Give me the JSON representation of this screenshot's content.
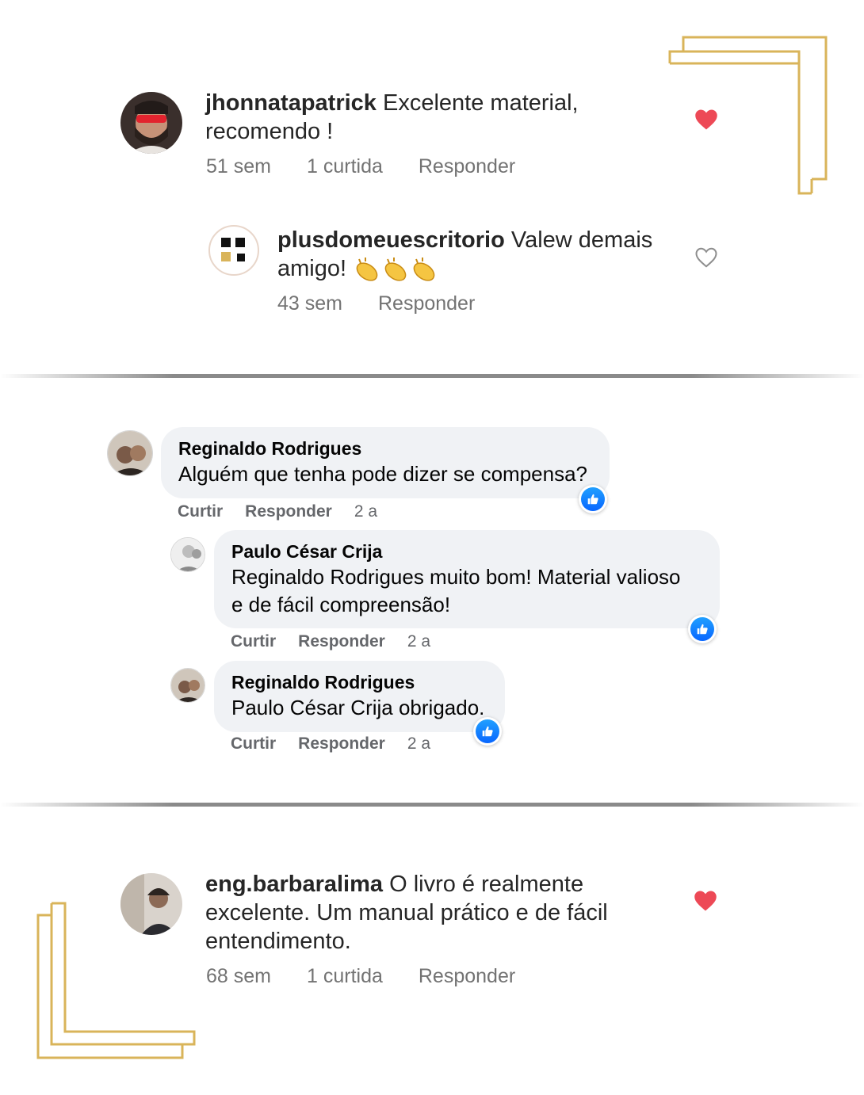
{
  "colors": {
    "gold_frame": "#d9b45a",
    "ig_heart_red": "#ed4956",
    "fb_blue": "#0866ff",
    "bubble_bg": "#f0f2f5"
  },
  "instagram_top": {
    "comment": {
      "username": "jhonnatapatrick",
      "text_line1": "Excelente material,",
      "text_line2": "recomendo !",
      "time": "51 sem",
      "likes": "1 curtida",
      "reply": "Responder",
      "liked": true,
      "heart_icon": "heart-filled-icon"
    },
    "reply": {
      "username": "plusdomeuescritorio",
      "text_line1": "Valew demais",
      "text_line2": "amigo!",
      "emoji": "clapping-hands",
      "time": "43 sem",
      "reply": "Responder",
      "liked": false,
      "heart_icon": "heart-outline-icon"
    }
  },
  "facebook_thread": {
    "comment": {
      "name": "Reginaldo Rodrigues",
      "text": "Alguém que tenha pode dizer se compensa?",
      "like": "Curtir",
      "reply": "Responder",
      "time": "2 a"
    },
    "replies": [
      {
        "name": "Paulo César Crija",
        "text_line1": "Reginaldo Rodrigues muito bom! Material valioso",
        "text_line2": "e de fácil compreensão!",
        "like": "Curtir",
        "reply": "Responder",
        "time": "2 a"
      },
      {
        "name": "Reginaldo Rodrigues",
        "text": "Paulo César Crija obrigado.",
        "like": "Curtir",
        "reply": "Responder",
        "time": "2 a"
      }
    ]
  },
  "instagram_bottom": {
    "comment": {
      "username": "eng.barbaralima",
      "text_line1": "O livro é realmente",
      "text_line2": "excelente. Um manual prático e de fácil",
      "text_line3": "entendimento.",
      "time": "68 sem",
      "likes": "1 curtida",
      "reply": "Responder",
      "liked": true,
      "heart_icon": "heart-filled-icon"
    }
  }
}
